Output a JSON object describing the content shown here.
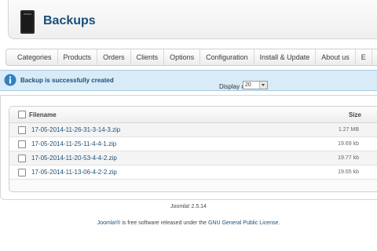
{
  "header": {
    "title": "Backups",
    "icon": "server-icon"
  },
  "menu": {
    "items": [
      "Categories",
      "Products",
      "Orders",
      "Clients",
      "Options",
      "Configuration",
      "Install & Update",
      "About us",
      "E"
    ]
  },
  "message": {
    "icon": "info-icon",
    "text": "Backup is successfully created",
    "color": "#1a4f7a"
  },
  "table": {
    "columns": {
      "filename": "Filename",
      "size": "Size"
    },
    "rows": [
      {
        "filename": "17-05-2014-11-26-31-3-14-3.zip",
        "size": "1.27 MB"
      },
      {
        "filename": "17-05-2014-11-25-11-4-4-1.zip",
        "size": "19.69 kb"
      },
      {
        "filename": "17-05-2014-11-20-53-4-4-2.zip",
        "size": "19.77 kb"
      },
      {
        "filename": "17-05-2014-11-13-06-4-2-2.zip",
        "size": "19.65 kb"
      }
    ]
  },
  "pagination": {
    "display_label": "Display #",
    "display_value": "20"
  },
  "footer": {
    "version": "Joomla! 2.5.14",
    "license_link1": "Joomla!®",
    "license_text": " is free software released under the ",
    "license_link2": "GNU General Public License",
    "license_end": "."
  }
}
